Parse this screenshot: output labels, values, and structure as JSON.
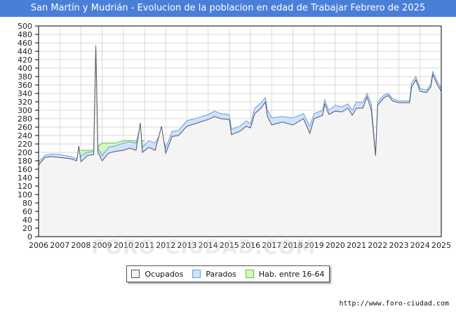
{
  "page": {
    "title": "San Martín y Mudrián - Evolucion de la poblacion en edad de Trabajar Febrero de 2025",
    "footer_url": "http://www.foro-ciudad.com",
    "watermark": "FORO-CIUDAD.COM"
  },
  "colors": {
    "title_bar": "#4a7fd8",
    "ocupados_fill": "#f4f4f4",
    "ocupados_line": "#555566",
    "parados_fill": "#cfe2fb",
    "parados_line": "#6b9fdc",
    "hab_fill": "#d2f7c0",
    "hab_line": "#66bb44"
  },
  "chart_data": {
    "type": "area",
    "title": "San Martín y Mudrián - Evolucion de la poblacion en edad de Trabajar Febrero de 2025",
    "xlabel": "",
    "ylabel": "",
    "xlim": [
      2006,
      2025
    ],
    "ylim": [
      0,
      500
    ],
    "y_ticks": [
      0,
      20,
      40,
      60,
      80,
      100,
      120,
      140,
      160,
      180,
      200,
      220,
      240,
      260,
      280,
      300,
      320,
      340,
      360,
      380,
      400,
      420,
      440,
      460,
      480,
      500
    ],
    "x_ticks": [
      2006,
      2007,
      2008,
      2009,
      2010,
      2011,
      2012,
      2013,
      2014,
      2015,
      2016,
      2017,
      2018,
      2019,
      2020,
      2021,
      2022,
      2023,
      2024,
      2025
    ],
    "grid": true,
    "legend_position": "bottom",
    "legend": [
      "Ocupados",
      "Parados",
      "Hab. entre 16-64"
    ],
    "series": [
      {
        "name": "Hab. entre 16-64",
        "points": [
          [
            2008.0,
            205
          ],
          [
            2008.6,
            205
          ],
          [
            2009.0,
            222
          ],
          [
            2009.6,
            222
          ],
          [
            2010.0,
            228
          ],
          [
            2010.9,
            228
          ],
          [
            2011.0,
            228
          ]
        ]
      },
      {
        "name": "Parados",
        "points": [
          [
            2006.0,
            178
          ],
          [
            2006.3,
            193
          ],
          [
            2006.6,
            196
          ],
          [
            2007.0,
            195
          ],
          [
            2007.5,
            190
          ],
          [
            2007.8,
            185
          ],
          [
            2008.0,
            192
          ],
          [
            2008.3,
            200
          ],
          [
            2008.6,
            202
          ],
          [
            2008.7,
            455
          ],
          [
            2008.8,
            210
          ],
          [
            2009.0,
            192
          ],
          [
            2009.3,
            212
          ],
          [
            2009.6,
            215
          ],
          [
            2010.0,
            222
          ],
          [
            2010.3,
            225
          ],
          [
            2010.6,
            222
          ],
          [
            2010.8,
            262
          ],
          [
            2010.9,
            212
          ],
          [
            2011.2,
            228
          ],
          [
            2011.5,
            222
          ],
          [
            2011.8,
            250
          ],
          [
            2012.0,
            210
          ],
          [
            2012.3,
            250
          ],
          [
            2012.6,
            252
          ],
          [
            2013.0,
            275
          ],
          [
            2013.5,
            282
          ],
          [
            2014.0,
            290
          ],
          [
            2014.3,
            298
          ],
          [
            2014.6,
            292
          ],
          [
            2015.0,
            290
          ],
          [
            2015.1,
            255
          ],
          [
            2015.5,
            262
          ],
          [
            2015.8,
            275
          ],
          [
            2016.0,
            268
          ],
          [
            2016.2,
            305
          ],
          [
            2016.5,
            318
          ],
          [
            2016.7,
            330
          ],
          [
            2016.8,
            300
          ],
          [
            2017.0,
            282
          ],
          [
            2017.5,
            285
          ],
          [
            2018.0,
            282
          ],
          [
            2018.5,
            292
          ],
          [
            2018.8,
            262
          ],
          [
            2019.0,
            292
          ],
          [
            2019.4,
            300
          ],
          [
            2019.5,
            325
          ],
          [
            2019.7,
            300
          ],
          [
            2020.0,
            312
          ],
          [
            2020.3,
            308
          ],
          [
            2020.6,
            315
          ],
          [
            2020.8,
            300
          ],
          [
            2021.0,
            320
          ],
          [
            2021.3,
            318
          ],
          [
            2021.5,
            340
          ],
          [
            2021.7,
            315
          ],
          [
            2021.9,
            195
          ],
          [
            2022.0,
            320
          ],
          [
            2022.3,
            336
          ],
          [
            2022.5,
            340
          ],
          [
            2022.7,
            328
          ],
          [
            2023.0,
            322
          ],
          [
            2023.5,
            322
          ],
          [
            2023.6,
            365
          ],
          [
            2023.8,
            380
          ],
          [
            2024.0,
            352
          ],
          [
            2024.3,
            348
          ],
          [
            2024.5,
            360
          ],
          [
            2024.6,
            392
          ],
          [
            2024.8,
            370
          ],
          [
            2025.0,
            352
          ]
        ]
      },
      {
        "name": "Ocupados",
        "points": [
          [
            2006.0,
            170
          ],
          [
            2006.3,
            188
          ],
          [
            2006.6,
            190
          ],
          [
            2007.0,
            188
          ],
          [
            2007.5,
            185
          ],
          [
            2007.8,
            180
          ],
          [
            2007.9,
            215
          ],
          [
            2008.0,
            178
          ],
          [
            2008.3,
            192
          ],
          [
            2008.6,
            195
          ],
          [
            2008.7,
            450
          ],
          [
            2008.8,
            200
          ],
          [
            2009.0,
            180
          ],
          [
            2009.3,
            198
          ],
          [
            2009.6,
            202
          ],
          [
            2010.0,
            205
          ],
          [
            2010.3,
            210
          ],
          [
            2010.6,
            205
          ],
          [
            2010.8,
            270
          ],
          [
            2010.9,
            200
          ],
          [
            2011.2,
            212
          ],
          [
            2011.5,
            205
          ],
          [
            2011.8,
            262
          ],
          [
            2012.0,
            198
          ],
          [
            2012.3,
            238
          ],
          [
            2012.6,
            240
          ],
          [
            2013.0,
            262
          ],
          [
            2013.5,
            270
          ],
          [
            2014.0,
            278
          ],
          [
            2014.3,
            285
          ],
          [
            2014.6,
            280
          ],
          [
            2015.0,
            278
          ],
          [
            2015.1,
            242
          ],
          [
            2015.5,
            250
          ],
          [
            2015.8,
            262
          ],
          [
            2016.0,
            258
          ],
          [
            2016.2,
            292
          ],
          [
            2016.5,
            305
          ],
          [
            2016.7,
            320
          ],
          [
            2016.8,
            285
          ],
          [
            2017.0,
            265
          ],
          [
            2017.5,
            272
          ],
          [
            2018.0,
            265
          ],
          [
            2018.5,
            280
          ],
          [
            2018.8,
            245
          ],
          [
            2019.0,
            280
          ],
          [
            2019.4,
            288
          ],
          [
            2019.5,
            315
          ],
          [
            2019.7,
            290
          ],
          [
            2020.0,
            298
          ],
          [
            2020.3,
            296
          ],
          [
            2020.6,
            305
          ],
          [
            2020.8,
            288
          ],
          [
            2021.0,
            305
          ],
          [
            2021.3,
            305
          ],
          [
            2021.5,
            332
          ],
          [
            2021.7,
            300
          ],
          [
            2021.9,
            192
          ],
          [
            2022.0,
            312
          ],
          [
            2022.3,
            330
          ],
          [
            2022.5,
            335
          ],
          [
            2022.7,
            322
          ],
          [
            2023.0,
            318
          ],
          [
            2023.5,
            318
          ],
          [
            2023.6,
            355
          ],
          [
            2023.8,
            372
          ],
          [
            2024.0,
            345
          ],
          [
            2024.3,
            342
          ],
          [
            2024.5,
            355
          ],
          [
            2024.6,
            385
          ],
          [
            2024.8,
            362
          ],
          [
            2025.0,
            345
          ]
        ]
      }
    ]
  }
}
